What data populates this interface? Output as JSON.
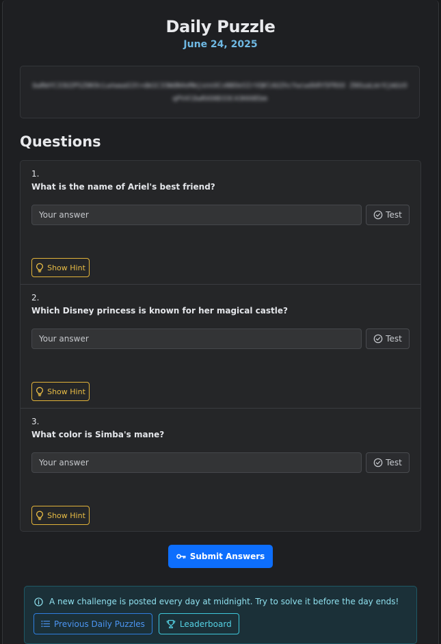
{
  "header": {
    "title": "Daily Puzzle",
    "date": "June 24, 2025"
  },
  "cipher": {
    "text": "bwRmYC33U2PSZ0K9cLwnwwaS3t+dm1C33WdN4eMmjsnnXCxN8OeSIrVQKlAU2hcYwcwdkRY5FRXX Z0OuaLmrXjmUzOqPV4lDwRXO0D33C43HX0Ebm"
  },
  "questions_heading": "Questions",
  "questions": [
    {
      "number": "1.",
      "text": "What is the name of Ariel's best friend?",
      "answer_placeholder": "Your answer",
      "answer_value": "",
      "test_label": "Test",
      "hint_label": "Show Hint"
    },
    {
      "number": "2.",
      "text": "Which Disney princess is known for her magical castle?",
      "answer_placeholder": "Your answer",
      "answer_value": "",
      "test_label": "Test",
      "hint_label": "Show Hint"
    },
    {
      "number": "3.",
      "text": "What color is Simba's mane?",
      "answer_placeholder": "Your answer",
      "answer_value": "",
      "test_label": "Test",
      "hint_label": "Show Hint"
    }
  ],
  "submit": {
    "label": "Submit Answers",
    "icon": "key-icon"
  },
  "info": {
    "icon": "info-circle-icon",
    "text": "A new challenge is posted every day at midnight. Try to solve it before the day ends!",
    "previous_label": "Previous Daily Puzzles",
    "leaderboard_label": "Leaderboard"
  },
  "colors": {
    "primary": "#0d6efd",
    "date_accent": "#6fb9e4",
    "hint": "#e3b43a",
    "info_bg": "#1b3038",
    "info_text": "#8fe0ee",
    "leaderboard": "#3fc9dc"
  }
}
